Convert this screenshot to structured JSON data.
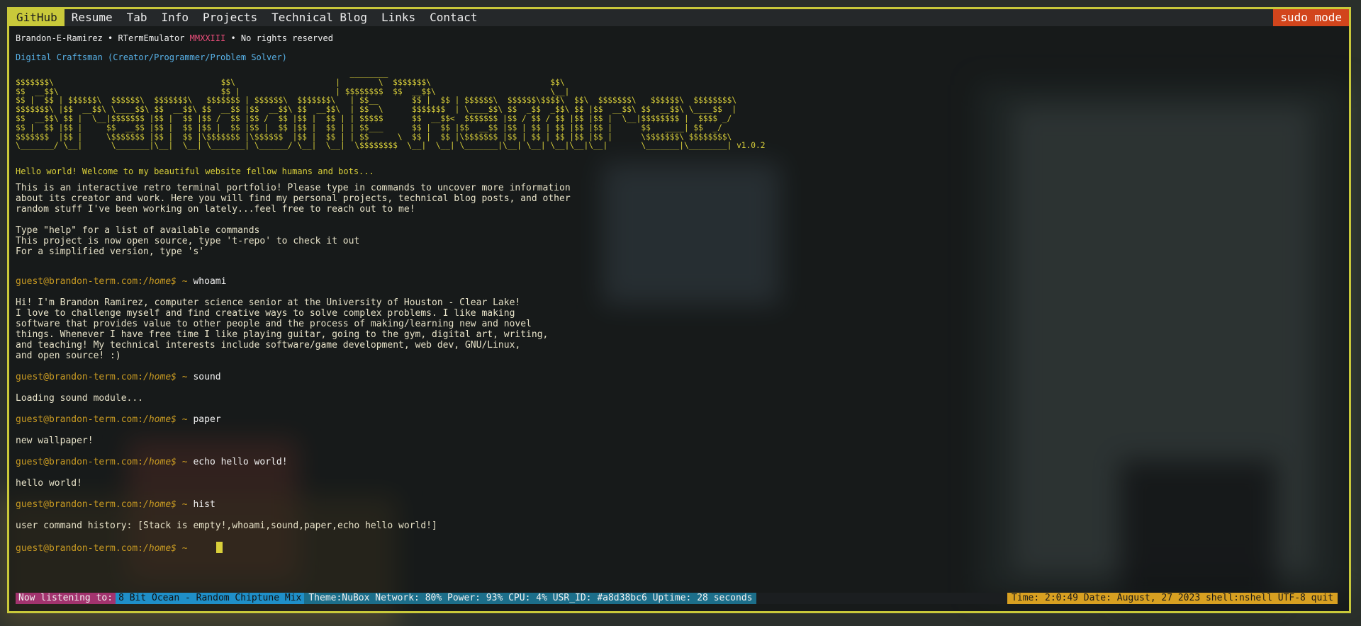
{
  "nav": {
    "items": [
      "GitHub",
      "Resume",
      "Tab",
      "Info",
      "Projects",
      "Technical Blog",
      "Links",
      "Contact"
    ],
    "sudo": "sudo mode"
  },
  "header": {
    "author": "Brandon-E-Ramirez • RTermEmulator ",
    "year": "MMXXIII",
    "rights": " • No rights reserved",
    "tagline": "Digital Craftsman (Creator/Programmer/Problem Solver)"
  },
  "banner": {
    "lines": [
      "                                                                      ________",
      "$$$$$$$\\                                   $$\\                     |        \\  $$$$$$$\\                         $$\\",
      "$$  __$$\\                                  $$ |                    | $$$$$$$$  $$  __$$\\                        \\__|",
      "$$ |  $$ | $$$$$$\\  $$$$$$\\  $$$$$$$\\   $$$$$$$ | $$$$$$\\  $$$$$$$\\   | $$__       $$ |  $$ | $$$$$$\\  $$$$$$\\$$$$\\  $$\\  $$$$$$$\\   $$$$$$\\  $$$$$$$$\\",
      "$$$$$$$\\ |$$  __$$\\ \\____$$\\ $$  __$$\\ $$  __$$ |$$  __$$\\ $$  __$$\\  | $$  \\      $$$$$$$  | \\____$$\\ $$  _$$  _$$\\ $$ |$$  __$$\\ $$  __$$\\ \\____$$  |",
      "$$  __$$\\ $$ |  \\__|$$$$$$$ |$$ |  $$ |$$ /  $$ |$$ /  $$ |$$ |  $$ | | $$$$$      $$  __$$<  $$$$$$$ |$$ / $$ / $$ |$$ |$$ |  \\__|$$$$$$$$ |  $$$$ _/",
      "$$ |  $$ |$$ |     $$  __$$ |$$ |  $$ |$$ |  $$ |$$ |  $$ |$$ |  $$ | | $$___      $$ |  $$ |$$  __$$ |$$ | $$ | $$ |$$ |$$ |      $$   ____| $$  _/",
      "$$$$$$$  |$$ |     \\$$$$$$$ |$$ |  $$ |\\$$$$$$$ |\\$$$$$$  |$$ |  $$ | | $$      \\  $$ |  $$ |\\$$$$$$$ |$$ | $$ | $$ |$$ |$$ |      \\$$$$$$$\\ $$$$$$$$\\",
      "\\_______/ \\__|      \\_______|\\__|  \\__| \\_______| \\______/ \\__|  \\__|  \\$$$$$$$$  \\__|  \\__| \\_______|\\__| \\__| \\__|\\__|\\__|       \\_______|\\________|"
    ],
    "version": " v1.0.2"
  },
  "intro": {
    "hello": "Hello world! Welcome to my beautiful website fellow humans and bots...",
    "para": [
      "This is an interactive retro terminal portfolio! Please type in commands to uncover more information",
      "about its creator and work. Here you will find my personal projects, technical blog posts, and other",
      "random stuff I've been working on lately...feel free to reach out to me!"
    ],
    "help": [
      "Type \"help\" for a list of available commands",
      "This project is now open source, type 't-repo' to check it out",
      "For a simplified version, type 's'"
    ]
  },
  "prompt": {
    "host": "guest@brandon-term.com:",
    "path": "/home$",
    "tilde": " ~ "
  },
  "session": [
    {
      "cmd": "whoami",
      "out": [
        "Hi! I'm Brandon Ramirez, computer science senior at the University of Houston - Clear Lake!",
        "I love to challenge myself and find creative ways to solve complex problems. I like making",
        "software that provides value to other people and the process of making/learning new and novel",
        "things. Whenever I have free time I like playing guitar, going to the gym, digital art, writing,",
        "and teaching! My technical interests include software/game development, web dev, GNU/Linux,",
        "and open source! :)"
      ]
    },
    {
      "cmd": "sound",
      "out": [
        "Loading sound module..."
      ]
    },
    {
      "cmd": "paper",
      "out": [
        "new wallpaper!"
      ]
    },
    {
      "cmd": "echo hello world!",
      "out": [
        "hello world!"
      ]
    },
    {
      "cmd": "hist",
      "out": [
        "user command history: [Stack is empty!,whoami,sound,paper,echo hello world!]"
      ]
    }
  ],
  "status": {
    "listening_label": "Now listening to:",
    "track": "8 Bit Ocean - Random Chiptune Mix",
    "info": "Theme:NuBox Network: 80% Power: 93% CPU: 4% USR_ID: #a8d38bc6 Uptime: 28 seconds",
    "right": "Time: 2:0:49 Date: August, 27 2023 shell:nshell UTF-8 quit"
  },
  "colors": {
    "frame": "#c9c93a",
    "accent_yellow": "#d9cf3a",
    "prompt": "#c89a22",
    "sudo": "#d2451c"
  }
}
